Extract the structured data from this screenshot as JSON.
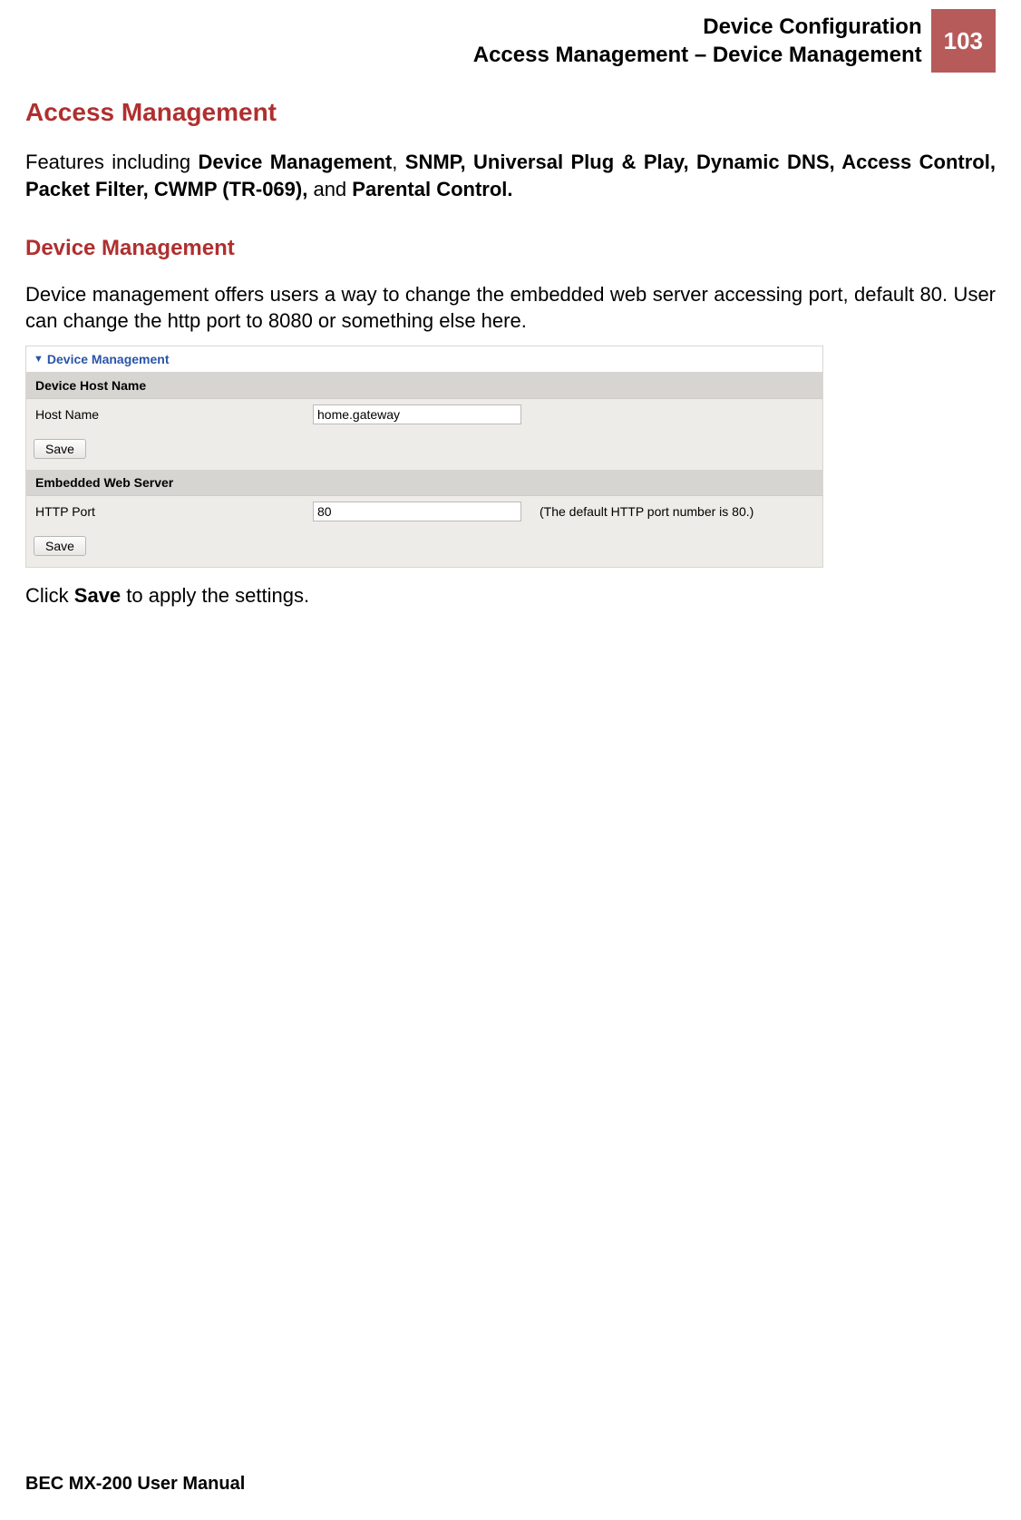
{
  "header": {
    "line1": "Device Configuration",
    "line2": "Access Management – Device Management",
    "page_number": "103"
  },
  "section": {
    "title_main": "Access Management",
    "intro_prefix": "Features including ",
    "intro_bold1": "Device Management",
    "intro_mid1": ", ",
    "intro_bold2": "SNMP, Universal Plug & Play, Dynamic DNS, Access Control, Packet Filter, CWMP (TR-069),",
    "intro_mid2": " and ",
    "intro_bold3": "Parental Control.",
    "title_sub": "Device Management",
    "desc": "Device management offers users a way to change the embedded web server accessing port, default 80. User can change the http port to 8080 or something else here.",
    "closing_prefix": "Click ",
    "closing_bold": "Save",
    "closing_suffix": " to apply the settings."
  },
  "panel": {
    "title": "Device Management",
    "device_host_name_header": "Device Host Name",
    "host_name_label": "Host Name",
    "host_name_value": "home.gateway",
    "save_label_1": "Save",
    "embedded_header": "Embedded Web Server",
    "http_port_label": "HTTP Port",
    "http_port_value": "80",
    "http_port_hint": "(The default HTTP port number is 80.)",
    "save_label_2": "Save"
  },
  "footer": {
    "text": "BEC MX-200 User Manual"
  }
}
